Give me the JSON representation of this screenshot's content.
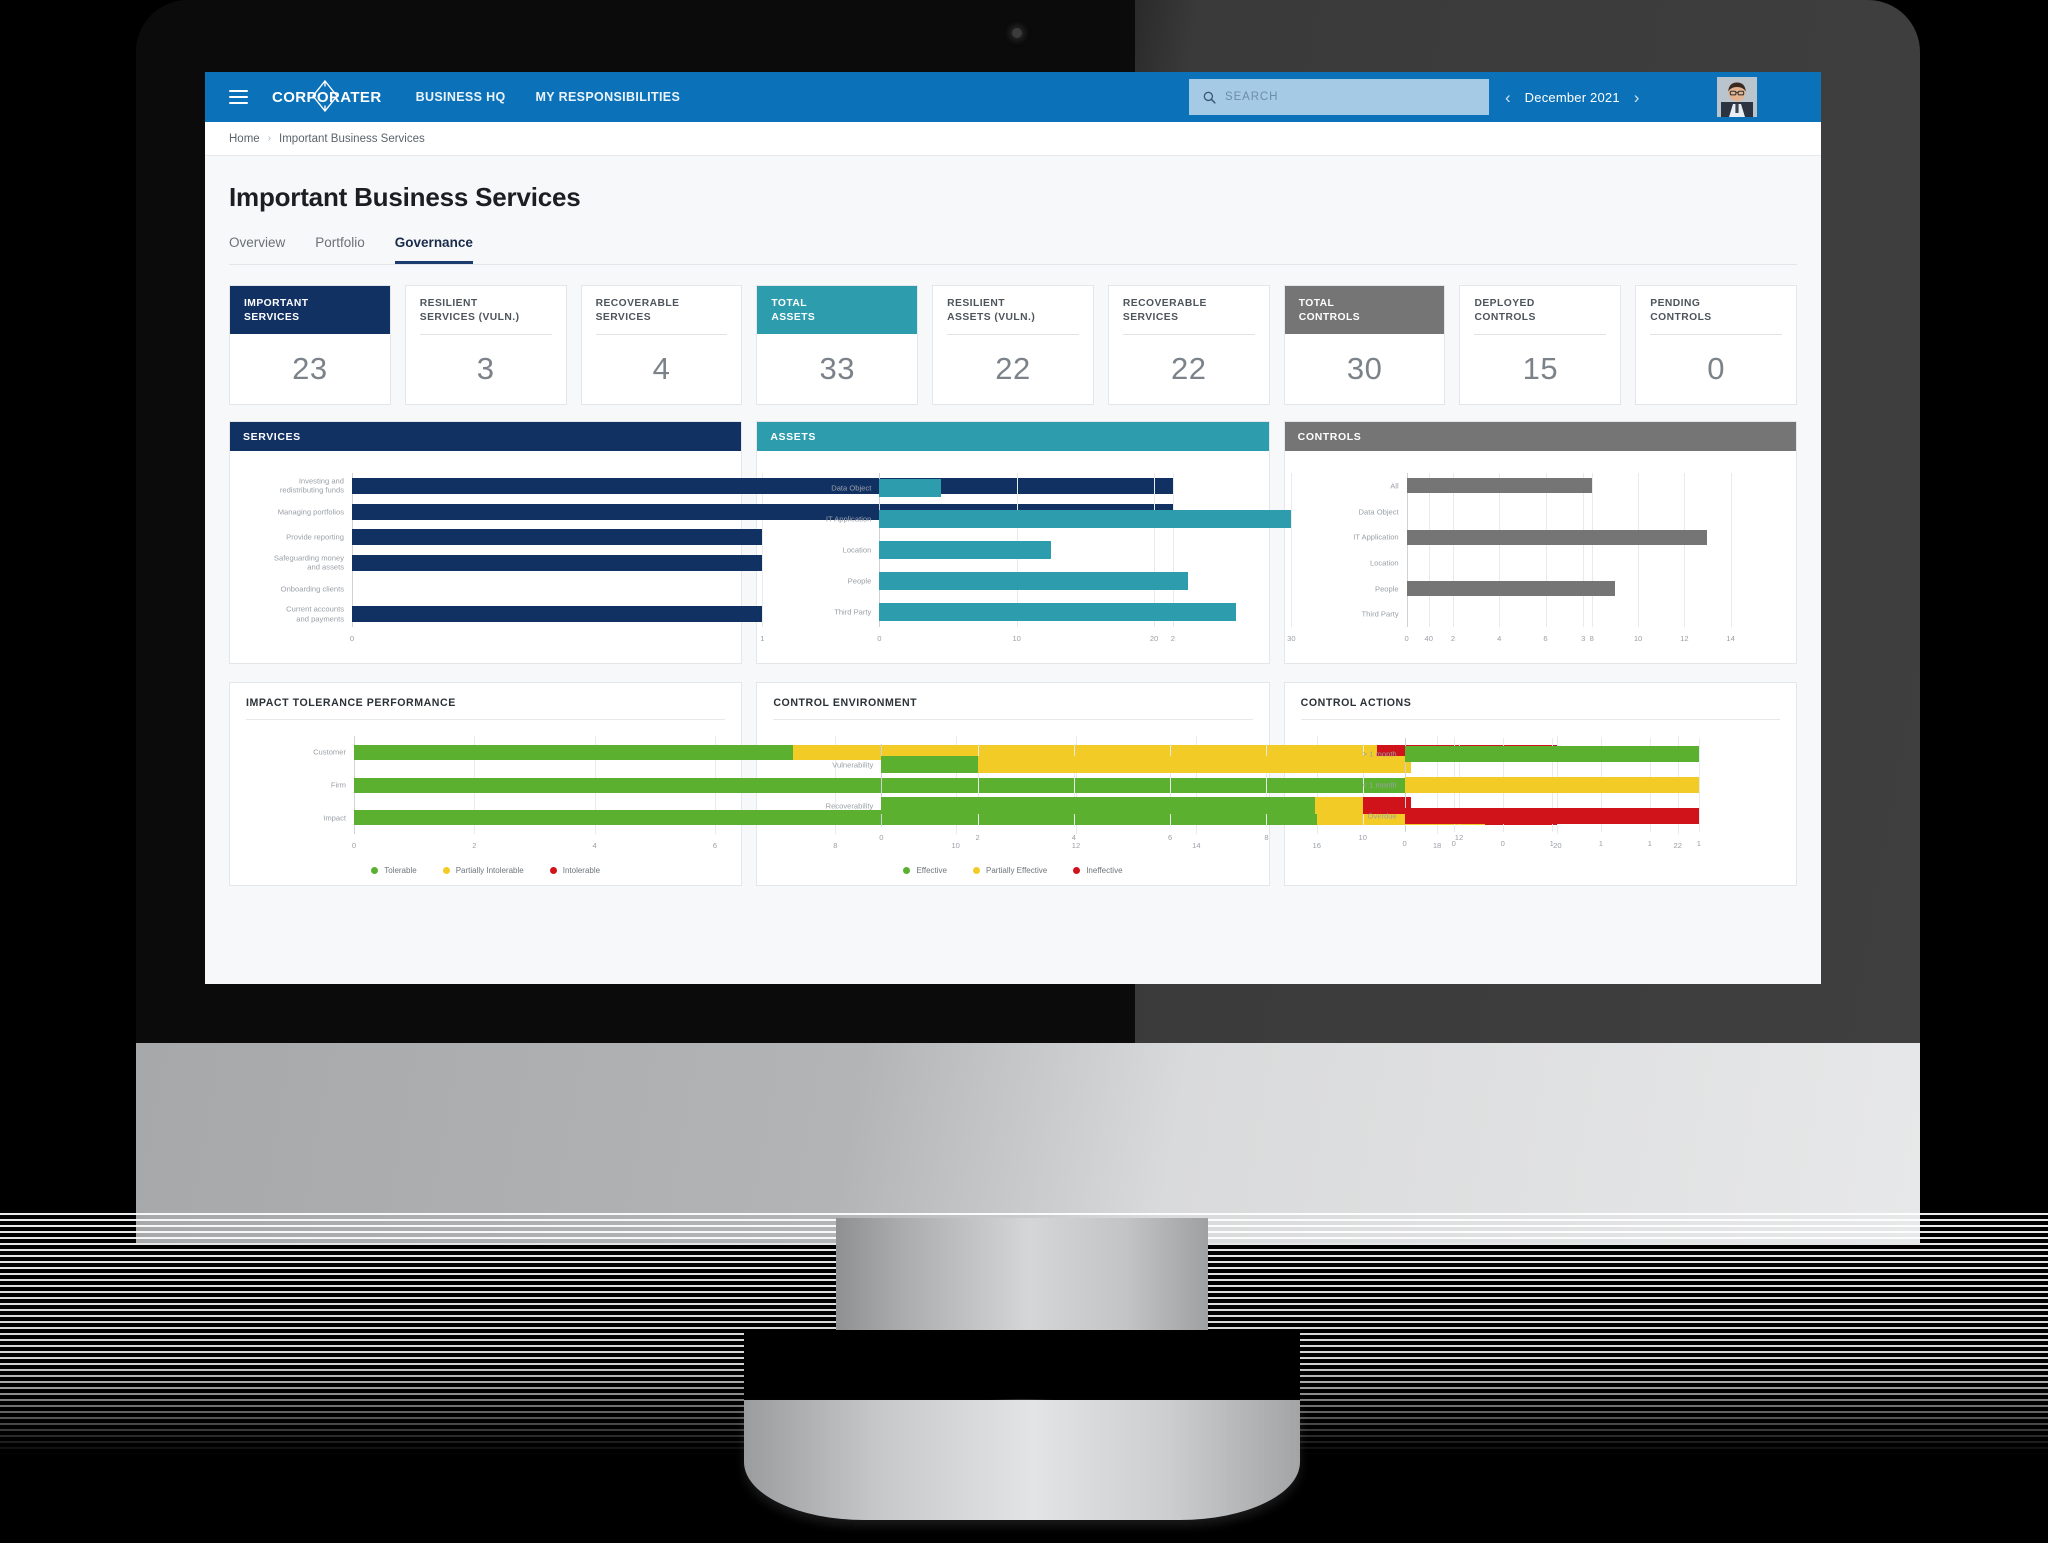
{
  "appbar": {
    "menu_icon": "hamburger-icon",
    "brand": "CORPORATER",
    "nav": [
      {
        "label": "BUSINESS HQ"
      },
      {
        "label": "MY RESPONSIBILITIES"
      }
    ],
    "search": {
      "placeholder": "SEARCH",
      "value": "",
      "icon": "search-icon"
    },
    "period": {
      "prev_icon": "chevron-left-icon",
      "label": "December 2021",
      "next_icon": "chevron-right-icon"
    },
    "avatar": "user-avatar"
  },
  "breadcrumb": {
    "home": "Home",
    "separator": "›",
    "current": "Important Business Services"
  },
  "page": {
    "title": "Important Business Services",
    "tabs": [
      {
        "label": "Overview",
        "active": false
      },
      {
        "label": "Portfolio",
        "active": false
      },
      {
        "label": "Governance",
        "active": true
      }
    ]
  },
  "colors": {
    "navy": "#123163",
    "teal": "#2d9cad",
    "gray": "#757575",
    "brand_blue": "#0b72ba",
    "green": "#5cb030",
    "yellow": "#f3cb26",
    "red": "#d0121b"
  },
  "kpis": [
    {
      "title": "IMPORTANT\nSERVICES",
      "value": "23",
      "fill": "#123163"
    },
    {
      "title": "RESILIENT\nSERVICES (VULN.)",
      "value": "3",
      "fill": null
    },
    {
      "title": "RECOVERABLE\nSERVICES",
      "value": "4",
      "fill": null
    },
    {
      "title": "TOTAL\nASSETS",
      "value": "33",
      "fill": "#2d9cad"
    },
    {
      "title": "RESILIENT\nASSETS (VULN.)",
      "value": "22",
      "fill": null
    },
    {
      "title": "RECOVERABLE\nSERVICES",
      "value": "22",
      "fill": null
    },
    {
      "title": "TOTAL\nCONTROLS",
      "value": "30",
      "fill": "#757575"
    },
    {
      "title": "DEPLOYED\nCONTROLS",
      "value": "15",
      "fill": null
    },
    {
      "title": "PENDING\nCONTROLS",
      "value": "0",
      "fill": null
    }
  ],
  "panels_top": [
    {
      "title": "SERVICES",
      "header_color": "#123163"
    },
    {
      "title": "ASSETS",
      "header_color": "#2d9cad"
    },
    {
      "title": "CONTROLS",
      "header_color": "#757575"
    }
  ],
  "panels_bottom": [
    {
      "title": "IMPACT TOLERANCE PERFORMANCE"
    },
    {
      "title": "CONTROL ENVIRONMENT"
    },
    {
      "title": "CONTROL ACTIONS"
    }
  ],
  "chart_data": [
    {
      "id": "services",
      "type": "bar",
      "orientation": "horizontal",
      "title": "SERVICES",
      "categories": [
        "Investing and\nredistributing funds",
        "Managing portfolios",
        "Provide reporting",
        "Safeguarding money\nand assets",
        "Onboarding clients",
        "Current accounts\nand payments"
      ],
      "values": [
        2,
        2,
        1,
        1,
        0,
        1
      ],
      "color": "#123163",
      "xlabel": "",
      "ylabel": "",
      "xticks": [
        0,
        1,
        2,
        3
      ],
      "xlim": [
        0,
        3.45
      ],
      "grid": true,
      "legend": null
    },
    {
      "id": "assets",
      "type": "bar",
      "orientation": "horizontal",
      "title": "ASSETS",
      "categories": [
        "Data Object",
        "IT Application",
        "Location",
        "People",
        "Third Party"
      ],
      "values": [
        4.5,
        30,
        12.5,
        22.5,
        26
      ],
      "color": "#2d9cad",
      "xlabel": "",
      "ylabel": "",
      "xticks": [
        0,
        10,
        20,
        30,
        40
      ],
      "xlim": [
        0,
        45.5
      ],
      "grid": true,
      "legend": null
    },
    {
      "id": "controls",
      "type": "bar",
      "orientation": "horizontal",
      "title": "CONTROLS",
      "categories": [
        "All",
        "Data Object",
        "IT Application",
        "Location",
        "People",
        "Third Party"
      ],
      "values": [
        8,
        0,
        13,
        0,
        9,
        0
      ],
      "color": "#757575",
      "xlabel": "",
      "ylabel": "",
      "xticks": [
        0,
        2,
        4,
        6,
        8,
        10,
        12,
        14
      ],
      "xlim": [
        0,
        15.6
      ],
      "grid": true,
      "legend": null
    },
    {
      "id": "impact-tolerance-performance",
      "type": "bar",
      "orientation": "horizontal",
      "stacked": true,
      "title": "IMPACT TOLERANCE PERFORMANCE",
      "categories": [
        "Customer",
        "Firm",
        "Impact"
      ],
      "series": [
        {
          "name": "Tolerable",
          "color": "#5cb030",
          "values": [
            7.3,
            18.0,
            16.0
          ]
        },
        {
          "name": "Partially Intolerable",
          "color": "#f3cb26",
          "values": [
            9.7,
            0.0,
            2.8
          ]
        },
        {
          "name": "Intolerable",
          "color": "#d0121b",
          "values": [
            3.0,
            2.0,
            1.2
          ]
        }
      ],
      "xticks": [
        0,
        2,
        4,
        6,
        8,
        10,
        12,
        14,
        16,
        18,
        20,
        22
      ],
      "xlim": [
        0,
        23.5
      ],
      "grid": true,
      "legend": {
        "position": "bottom"
      }
    },
    {
      "id": "control-environment",
      "type": "bar",
      "orientation": "horizontal",
      "stacked": true,
      "title": "CONTROL ENVIRONMENT",
      "categories": [
        "Vulnerability",
        "Recoverability"
      ],
      "series": [
        {
          "name": "Effective",
          "color": "#5cb030",
          "values": [
            2.0,
            9.0
          ]
        },
        {
          "name": "Partially Effective",
          "color": "#f3cb26",
          "values": [
            9.0,
            1.0
          ]
        },
        {
          "name": "Ineffective",
          "color": "#d0121b",
          "values": [
            0.0,
            1.0
          ]
        }
      ],
      "xticks": [
        0,
        2,
        4,
        6,
        8,
        10,
        12
      ],
      "xlim": [
        0,
        12.9
      ],
      "grid": true,
      "legend": {
        "position": "bottom"
      }
    },
    {
      "id": "control-actions",
      "type": "bar",
      "orientation": "horizontal",
      "title": "CONTROL ACTIONS",
      "categories": [
        "> 1 month",
        "< 1 month",
        "Overdue"
      ],
      "values": [
        1,
        1,
        1
      ],
      "bar_colors": [
        "#5cb030",
        "#f3cb26",
        "#d0121b"
      ],
      "xticks": [
        0,
        0,
        0,
        1,
        1,
        1,
        1
      ],
      "xtick_positions": [
        0,
        0.1667,
        0.3333,
        0.5,
        0.6667,
        0.8333,
        1.0
      ],
      "xlim": [
        0,
        1.22
      ],
      "grid": true,
      "legend": null
    }
  ]
}
